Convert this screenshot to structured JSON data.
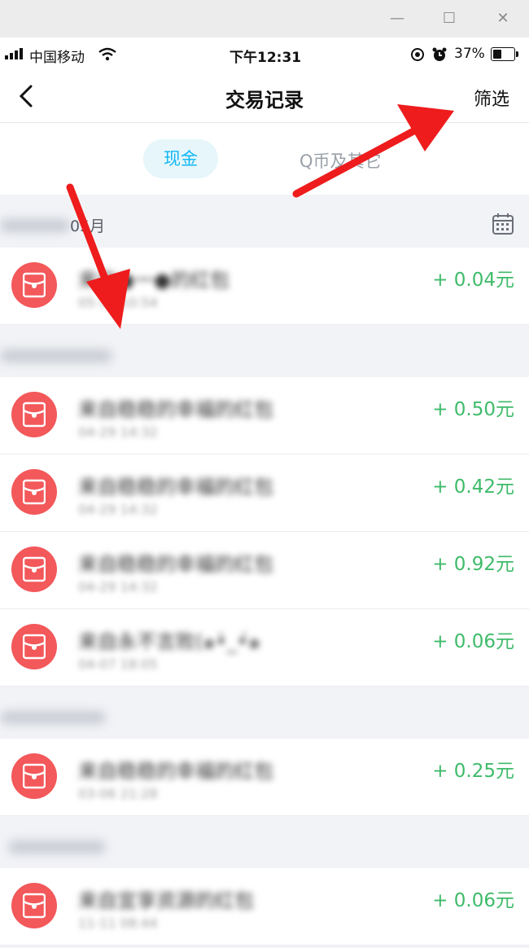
{
  "window": {
    "min": "—",
    "max": "☐",
    "close": "✕"
  },
  "status": {
    "carrier": "中国移动",
    "time": "下午12:31",
    "battery": "37%"
  },
  "nav": {
    "title": "交易记录",
    "filter": "筛选"
  },
  "tabs": {
    "cash": "现金",
    "other": "Q币及其它"
  },
  "sections": [
    {
      "label": "05月"
    },
    {
      "label": ""
    },
    {
      "label": ""
    },
    {
      "label": ""
    }
  ],
  "transactions": [
    {
      "title": "来自●一●的红包",
      "time": "05-12 10:54",
      "amount": "+ 0.04元"
    },
    {
      "title": "来自稳稳的幸福的红包",
      "time": "04-29 14:32",
      "amount": "+ 0.50元"
    },
    {
      "title": "来自稳稳的幸福的红包",
      "time": "04-29 14:32",
      "amount": "+ 0.42元"
    },
    {
      "title": "来自稳稳的幸福的红包",
      "time": "04-29 14:32",
      "amount": "+ 0.92元"
    },
    {
      "title": "来自永不言败(๑•̀_•́๑",
      "time": "04-07 18:05",
      "amount": "+ 0.06元"
    },
    {
      "title": "来自稳稳的幸福的红包",
      "time": "03-06 21:28",
      "amount": "+ 0.25元"
    },
    {
      "title": "来自宜享资源的红包",
      "time": "11-11 08:44",
      "amount": "+ 0.06元"
    }
  ]
}
